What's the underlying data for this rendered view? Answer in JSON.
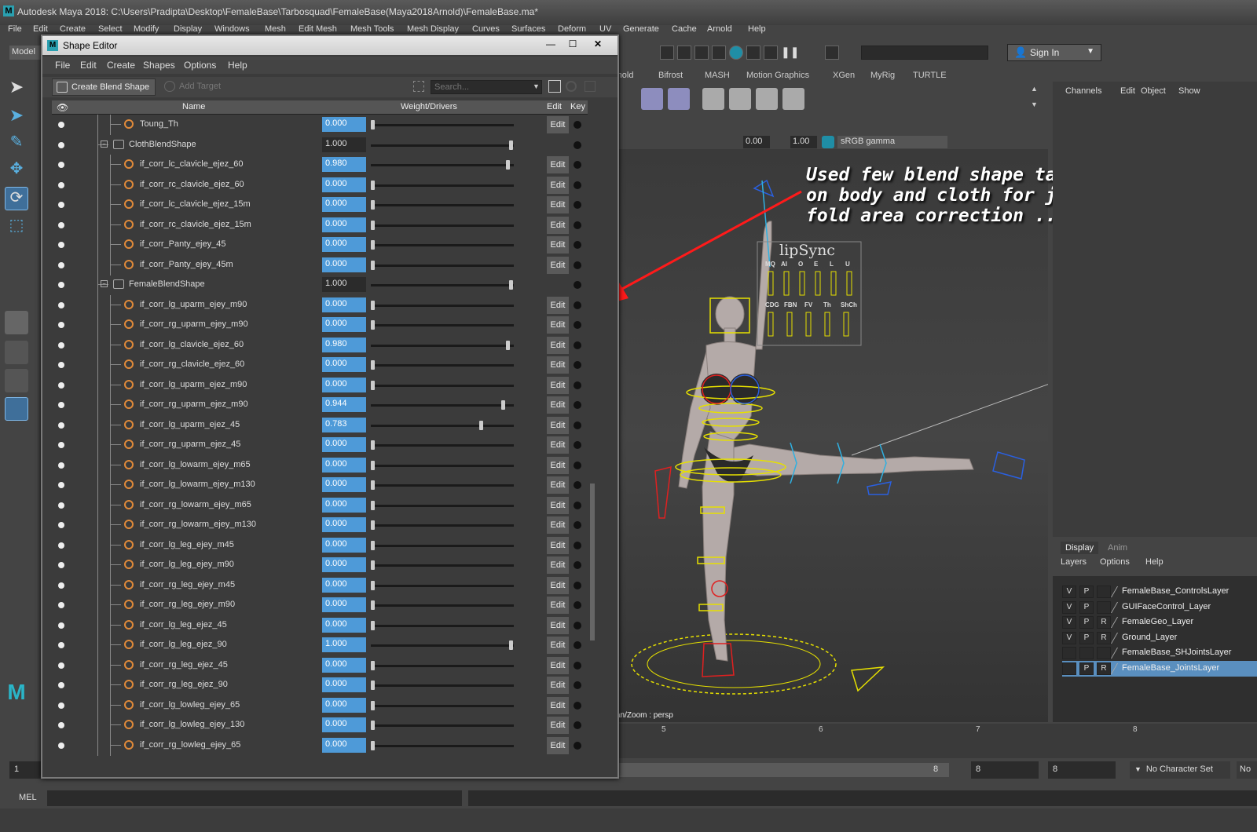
{
  "app": {
    "title": "Autodesk Maya 2018: C:\\Users\\Pradipta\\Desktop\\FemaleBase\\Tarbosquad\\FemaleBase(Maya2018Arnold)\\FemaleBase.ma*",
    "menu": [
      "File",
      "Edit",
      "Create",
      "Select",
      "Modify",
      "Display",
      "Windows",
      "Mesh",
      "Edit Mesh",
      "Mesh Tools",
      "Mesh Display",
      "Curves",
      "Surfaces",
      "Deform",
      "UV",
      "Generate",
      "Cache",
      "Arnold",
      "Help"
    ],
    "mode": "Model",
    "sign_in": "Sign In"
  },
  "shelf": {
    "tabs": [
      "rnold",
      "Bifrost",
      "MASH",
      "Motion Graphics",
      "XGen",
      "MyRig",
      "TURTLE"
    ]
  },
  "viewport": {
    "exposure": "0.00",
    "gamma": "1.00",
    "color_space": "sRGB gamma",
    "camera_hint": "an/Zoom : persp",
    "annotation": [
      "Used few blend shape target",
      "on body and cloth for joint",
      "fold area correction ..."
    ],
    "lipsync_title": "lipSync",
    "lipsync_row1": [
      "MQ",
      "AI",
      "O",
      "E",
      "L",
      "U"
    ],
    "lipsync_row2": [
      "CDG",
      "FBN",
      "FV",
      "Th",
      "ShCh"
    ]
  },
  "channel_box": {
    "menu": [
      "Channels",
      "Edit",
      "Object",
      "Show"
    ]
  },
  "layer_editor": {
    "tabs": [
      "Display",
      "Anim"
    ],
    "menu": [
      "Layers",
      "Options",
      "Help"
    ],
    "layers": [
      {
        "v": "V",
        "p": "P",
        "r": "",
        "name": "FemaleBase_ControlsLayer"
      },
      {
        "v": "V",
        "p": "P",
        "r": "",
        "name": "GUIFaceControl_Layer"
      },
      {
        "v": "V",
        "p": "P",
        "r": "R",
        "name": "FemaleGeo_Layer"
      },
      {
        "v": "V",
        "p": "P",
        "r": "R",
        "name": "Ground_Layer"
      },
      {
        "v": "",
        "p": "",
        "r": "",
        "name": "FemaleBase_SHJointsLayer"
      },
      {
        "v": "",
        "p": "P",
        "r": "R",
        "name": "FemaleBase_JointsLayer"
      }
    ]
  },
  "timeline": {
    "ticks": [
      "5",
      "6",
      "7",
      "8"
    ],
    "range_start": "1",
    "range_end_a": "8",
    "range_end_b": "8",
    "range_end_c": "8",
    "character_set": "No Character Set",
    "char_set_trunc": "No"
  },
  "command_line": {
    "label": "MEL"
  },
  "shape_editor": {
    "title": "Shape Editor",
    "menu": [
      "File",
      "Edit",
      "Create",
      "Shapes",
      "Options",
      "Help"
    ],
    "create_blend_shape": "Create Blend Shape",
    "add_target": "Add Target",
    "search_placeholder": "Search...",
    "columns": {
      "name": "Name",
      "weight": "Weight/Drivers",
      "edit": "Edit",
      "key": "Key"
    },
    "edit_label": "Edit",
    "rows": [
      {
        "name": "Toung_Th",
        "value": "0.000",
        "w": 0.0,
        "kind": "target"
      },
      {
        "name": "ClothBlendShape",
        "value": "1.000",
        "w": 1.0,
        "kind": "group"
      },
      {
        "name": "if_corr_lc_clavicle_ejez_60",
        "value": "0.980",
        "w": 0.98,
        "kind": "target"
      },
      {
        "name": "if_corr_rc_clavicle_ejez_60",
        "value": "0.000",
        "w": 0.0,
        "kind": "target"
      },
      {
        "name": "if_corr_lc_clavicle_ejez_15m",
        "value": "0.000",
        "w": 0.0,
        "kind": "target"
      },
      {
        "name": "if_corr_rc_clavicle_ejez_15m",
        "value": "0.000",
        "w": 0.0,
        "kind": "target"
      },
      {
        "name": "if_corr_Panty_ejey_45",
        "value": "0.000",
        "w": 0.0,
        "kind": "target"
      },
      {
        "name": "if_corr_Panty_ejey_45m",
        "value": "0.000",
        "w": 0.0,
        "kind": "target"
      },
      {
        "name": "FemaleBlendShape",
        "value": "1.000",
        "w": 1.0,
        "kind": "group"
      },
      {
        "name": "if_corr_lg_uparm_ejey_m90",
        "value": "0.000",
        "w": 0.0,
        "kind": "target"
      },
      {
        "name": "if_corr_rg_uparm_ejey_m90",
        "value": "0.000",
        "w": 0.0,
        "kind": "target"
      },
      {
        "name": "if_corr_lg_clavicle_ejez_60",
        "value": "0.980",
        "w": 0.98,
        "kind": "target"
      },
      {
        "name": "if_corr_rg_clavicle_ejez_60",
        "value": "0.000",
        "w": 0.0,
        "kind": "target"
      },
      {
        "name": "if_corr_lg_uparm_ejez_m90",
        "value": "0.000",
        "w": 0.0,
        "kind": "target"
      },
      {
        "name": "if_corr_rg_uparm_ejez_m90",
        "value": "0.944",
        "w": 0.944,
        "kind": "target"
      },
      {
        "name": "if_corr_lg_uparm_ejez_45",
        "value": "0.783",
        "w": 0.783,
        "kind": "target"
      },
      {
        "name": "if_corr_rg_uparm_ejez_45",
        "value": "0.000",
        "w": 0.0,
        "kind": "target"
      },
      {
        "name": "if_corr_lg_lowarm_ejey_m65",
        "value": "0.000",
        "w": 0.0,
        "kind": "target"
      },
      {
        "name": "if_corr_lg_lowarm_ejey_m130",
        "value": "0.000",
        "w": 0.0,
        "kind": "target"
      },
      {
        "name": "if_corr_rg_lowarm_ejey_m65",
        "value": "0.000",
        "w": 0.0,
        "kind": "target"
      },
      {
        "name": "if_corr_rg_lowarm_ejey_m130",
        "value": "0.000",
        "w": 0.0,
        "kind": "target"
      },
      {
        "name": "if_corr_lg_leg_ejey_m45",
        "value": "0.000",
        "w": 0.0,
        "kind": "target"
      },
      {
        "name": "if_corr_lg_leg_ejey_m90",
        "value": "0.000",
        "w": 0.0,
        "kind": "target"
      },
      {
        "name": "if_corr_rg_leg_ejey_m45",
        "value": "0.000",
        "w": 0.0,
        "kind": "target"
      },
      {
        "name": "if_corr_rg_leg_ejey_m90",
        "value": "0.000",
        "w": 0.0,
        "kind": "target"
      },
      {
        "name": "if_corr_lg_leg_ejez_45",
        "value": "0.000",
        "w": 0.0,
        "kind": "target"
      },
      {
        "name": "if_corr_lg_leg_ejez_90",
        "value": "1.000",
        "w": 1.0,
        "kind": "target"
      },
      {
        "name": "if_corr_rg_leg_ejez_45",
        "value": "0.000",
        "w": 0.0,
        "kind": "target"
      },
      {
        "name": "if_corr_rg_leg_ejez_90",
        "value": "0.000",
        "w": 0.0,
        "kind": "target"
      },
      {
        "name": "if_corr_lg_lowleg_ejey_65",
        "value": "0.000",
        "w": 0.0,
        "kind": "target"
      },
      {
        "name": "if_corr_lg_lowleg_ejey_130",
        "value": "0.000",
        "w": 0.0,
        "kind": "target"
      },
      {
        "name": "if_corr_rg_lowleg_ejey_65",
        "value": "0.000",
        "w": 0.0,
        "kind": "target"
      }
    ]
  }
}
